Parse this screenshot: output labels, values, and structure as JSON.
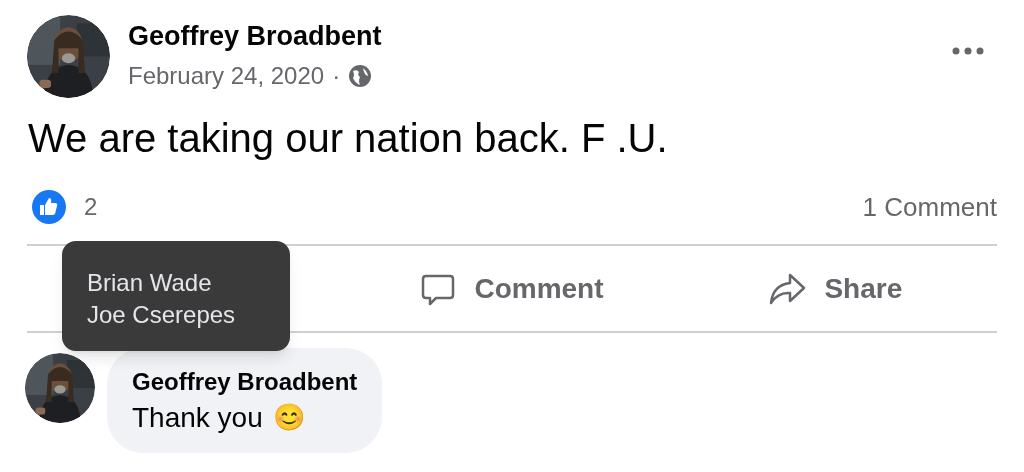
{
  "post": {
    "author": "Geoffrey Broadbent",
    "date": "February 24, 2020",
    "separator": "·",
    "text": "We are taking our nation back. F .U.",
    "reactions": {
      "count": "2"
    },
    "comments_count": "1 Comment"
  },
  "actions": [
    {
      "kind": "comment",
      "label": "Comment"
    },
    {
      "kind": "share",
      "label": "Share"
    }
  ],
  "tooltip": {
    "names": [
      "Brian Wade",
      "Joe Cserepes"
    ]
  },
  "comments": [
    {
      "author": "Geoffrey Broadbent",
      "text": "Thank you",
      "emoji": "😊"
    }
  ]
}
